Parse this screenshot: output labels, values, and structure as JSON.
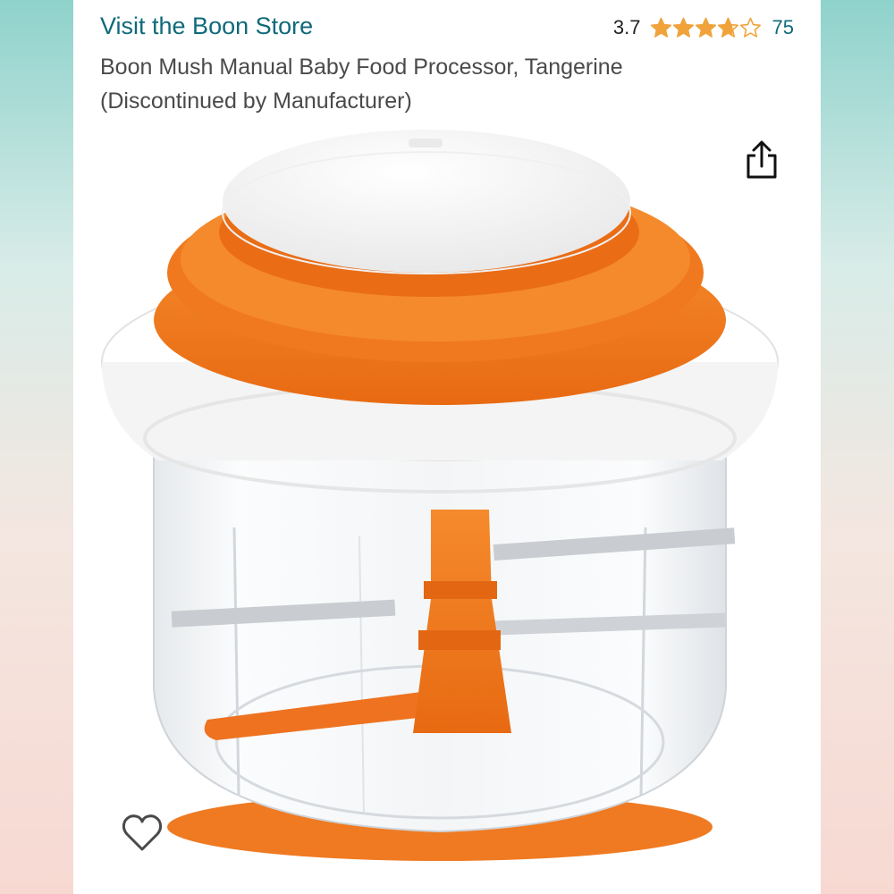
{
  "store": {
    "link_text": "Visit the Boon Store"
  },
  "rating": {
    "value": "3.7",
    "stars_out_of_5": 3.7,
    "count": "75"
  },
  "product": {
    "title_line1": "Boon Mush Manual Baby Food Processor, Tangerine",
    "title_line2": "(Discontinued by Manufacturer)"
  },
  "icons": {
    "share": "share-icon",
    "favorite": "heart-outline-icon",
    "star_color": "#f0a33a"
  },
  "colors": {
    "link": "#0f6a7a",
    "accent_orange": "#f07a1e"
  }
}
